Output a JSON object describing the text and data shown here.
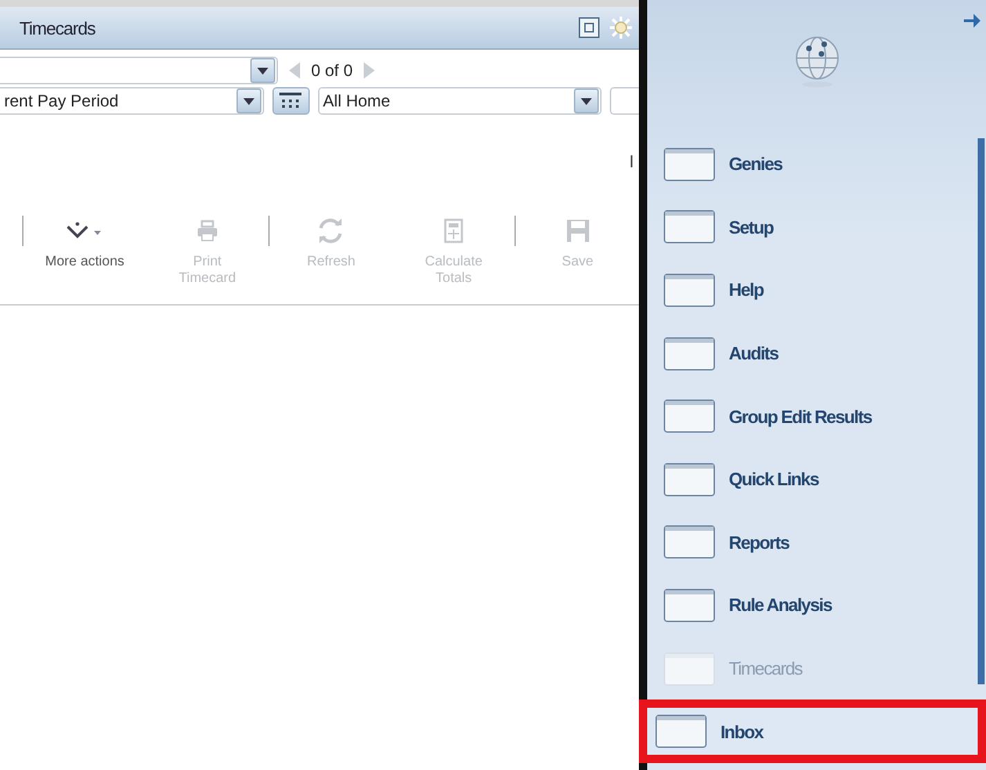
{
  "timecards_panel": {
    "title": "Timecards",
    "pager": {
      "text": "0 of 0"
    },
    "period_field": {
      "value": "rent Pay Period"
    },
    "location_field": {
      "value": "All Home"
    },
    "clipped_text": "l",
    "toolbar": [
      {
        "label": "More actions",
        "disabled": false,
        "separator_before": true
      },
      {
        "label": "Print Timecard",
        "disabled": true,
        "separator_before": false
      },
      {
        "label": "Refresh",
        "disabled": true,
        "separator_before": true
      },
      {
        "label": "Calculate Totals",
        "disabled": true,
        "separator_before": false
      },
      {
        "label": "Save",
        "disabled": true,
        "separator_before": true
      }
    ]
  },
  "nav_panel": {
    "items": [
      {
        "label": "Genies",
        "disabled": false,
        "highlighted": false
      },
      {
        "label": "Setup",
        "disabled": false,
        "highlighted": false
      },
      {
        "label": "Help",
        "disabled": false,
        "highlighted": false
      },
      {
        "label": "Audits",
        "disabled": false,
        "highlighted": false
      },
      {
        "label": "Group Edit Results",
        "disabled": false,
        "highlighted": false
      },
      {
        "label": "Quick Links",
        "disabled": false,
        "highlighted": false
      },
      {
        "label": "Reports",
        "disabled": false,
        "highlighted": false
      },
      {
        "label": "Rule Analysis",
        "disabled": false,
        "highlighted": false
      },
      {
        "label": "Timecards",
        "disabled": true,
        "highlighted": false
      },
      {
        "label": "Inbox",
        "disabled": false,
        "highlighted": true
      }
    ]
  }
}
